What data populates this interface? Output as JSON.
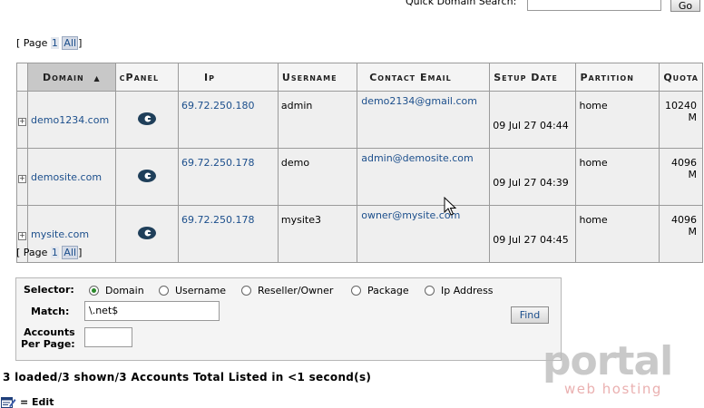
{
  "search": {
    "label": "Quick Domain Search:",
    "go_label": "Go"
  },
  "pager": {
    "open": "[ Page",
    "page": "1",
    "all": "All",
    "close": "]"
  },
  "table": {
    "headers": [
      "Domain",
      "cPanel",
      "Ip",
      "Username",
      "Contact Email",
      "Setup Date",
      "Partition",
      "Quota"
    ],
    "rows": [
      {
        "expand": "+",
        "domain": "demo1234.com",
        "ip": "69.72.250.180",
        "username": "admin",
        "email": "demo2134@gmail.com",
        "date": "09 Jul 27 04:44",
        "partition": "home",
        "quota": "10240 M"
      },
      {
        "expand": "+",
        "domain": "demosite.com",
        "ip": "69.72.250.178",
        "username": "demo",
        "email": "admin@demosite.com",
        "date": "09 Jul 27 04:39",
        "partition": "home",
        "quota": "4096 M"
      },
      {
        "expand": "+",
        "domain": "mysite.com",
        "ip": "69.72.250.178",
        "username": "mysite3",
        "email": "owner@mysite.com",
        "date": "09 Jul 27 04:45",
        "partition": "home",
        "quota": "4096 M"
      }
    ]
  },
  "selector": {
    "label": "Selector:",
    "options": [
      "Domain",
      "Username",
      "Reseller/Owner",
      "Package",
      "Ip Address"
    ],
    "selected": "Domain",
    "match_label": "Match:",
    "match_value": "\\.net$",
    "perpage_label_1": "Accounts",
    "perpage_label_2": "Per Page:",
    "find_label": "Find"
  },
  "summary": "3 loaded/3 shown/3 Accounts Total Listed in <1 second(s)",
  "legend": {
    "text": "= Edit",
    "icon": "edit-icon"
  },
  "watermark": {
    "title": "portal",
    "subtitle": "web hosting"
  },
  "colors": {
    "link": "#1c4f8c",
    "accent_red": "#e26b6b",
    "watermark_grey": "#b8b8b8"
  }
}
